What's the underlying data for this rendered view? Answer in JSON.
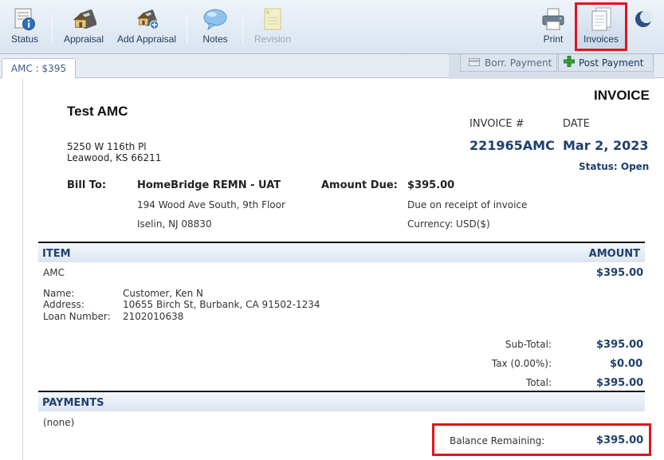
{
  "toolbar": {
    "status": "Status",
    "appraisal": "Appraisal",
    "add_appraisal": "Add Appraisal",
    "notes": "Notes",
    "revision": "Revision",
    "print": "Print",
    "invoices": "Invoices"
  },
  "tabs": {
    "amc": "AMC : $395",
    "borr_payment": "Borr. Payment",
    "post_payment": "Post Payment"
  },
  "invoice": {
    "title": "INVOICE",
    "company": "Test AMC",
    "address_line1": "5250 W 116th Pl",
    "address_line2": "Leawood, KS 66211",
    "invoice_num_label": "INVOICE #",
    "date_label": "DATE",
    "invoice_num": "221965AMC",
    "date": "Mar 2, 2023",
    "status": "Status: Open",
    "bill_to_label": "Bill To:",
    "bill_to_name": "HomeBridge REMN - UAT",
    "bill_to_addr1": "194 Wood Ave South, 9th Floor",
    "bill_to_addr2": "Iselin, NJ 08830",
    "amount_due_label": "Amount Due:",
    "amount_due": "$395.00",
    "due_note": "Due on receipt of invoice",
    "currency": "Currency: USD($)"
  },
  "items": {
    "item_header": "ITEM",
    "amount_header": "AMOUNT",
    "item_name": "AMC",
    "item_amount": "$395.00",
    "name_label": "Name:",
    "name_value": "Customer, Ken N",
    "address_label": "Address:",
    "address_value": "10655 Birch St, Burbank, CA 91502-1234",
    "loan_label": "Loan Number:",
    "loan_value": "2102010638"
  },
  "totals": {
    "subtotal_label": "Sub-Total:",
    "subtotal": "$395.00",
    "tax_label": "Tax (0.00%):",
    "tax": "$0.00",
    "total_label": "Total:",
    "total": "$395.00"
  },
  "payments": {
    "header": "PAYMENTS",
    "none": "(none)",
    "balance_label": "Balance Remaining:",
    "balance": "$395.00"
  }
}
